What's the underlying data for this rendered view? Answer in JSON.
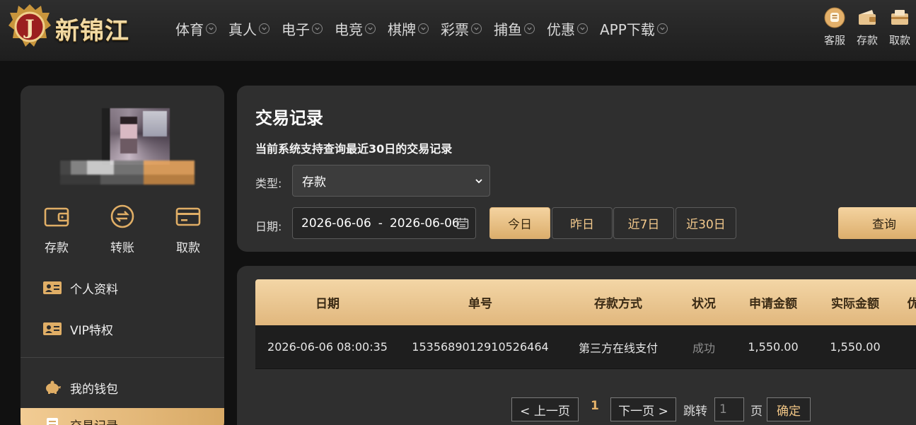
{
  "brand": {
    "name": "新锦江"
  },
  "nav": [
    {
      "label": "体育"
    },
    {
      "label": "真人"
    },
    {
      "label": "电子"
    },
    {
      "label": "电竞"
    },
    {
      "label": "棋牌"
    },
    {
      "label": "彩票"
    },
    {
      "label": "捕鱼"
    },
    {
      "label": "优惠"
    },
    {
      "label": "APP下载"
    }
  ],
  "top_actions": [
    {
      "label": "客服",
      "icon": "headset-icon"
    },
    {
      "label": "存款",
      "icon": "deposit-icon"
    },
    {
      "label": "取款",
      "icon": "withdraw-icon"
    }
  ],
  "sidebar": {
    "quick_actions": [
      {
        "label": "存款",
        "icon": "wallet-icon"
      },
      {
        "label": "转账",
        "icon": "transfer-icon"
      },
      {
        "label": "取款",
        "icon": "card-icon"
      }
    ],
    "menu": [
      {
        "label": "个人资料",
        "icon": "id-card-icon"
      },
      {
        "label": "VIP特权",
        "icon": "vip-card-icon"
      },
      {
        "label": "我的钱包",
        "icon": "piggy-bank-icon"
      },
      {
        "label": "交易记录",
        "icon": "record-icon",
        "active": true
      }
    ]
  },
  "filters": {
    "title": "交易记录",
    "notice": "当前系统支持查询最近30日的交易记录",
    "type_label": "类型:",
    "type_value": "存款",
    "date_label": "日期:",
    "date_start": "2026-06-06",
    "date_separator": "-",
    "date_end": "2026-06-06",
    "ranges": [
      {
        "label": "今日",
        "active": true
      },
      {
        "label": "昨日"
      },
      {
        "label": "近7日"
      },
      {
        "label": "近30日"
      }
    ],
    "search_label": "查询"
  },
  "table": {
    "headers": [
      "日期",
      "单号",
      "存款方式",
      "状况",
      "申请金额",
      "实际金额",
      "优"
    ],
    "rows": [
      [
        "2026-06-06 08:00:35",
        "1535689012910526464",
        "第三方在线支付",
        "成功",
        "1,550.00",
        "1,550.00",
        ""
      ]
    ]
  },
  "pagination": {
    "prev": "< 上一页",
    "current": "1",
    "next": "下一页 >",
    "jump_label": "跳转",
    "jump_placeholder": "1",
    "page_label": "页",
    "confirm": "确定"
  },
  "colors": {
    "accent": "#e1b77d",
    "background": "#111111",
    "panel": "#2f2f2f"
  }
}
